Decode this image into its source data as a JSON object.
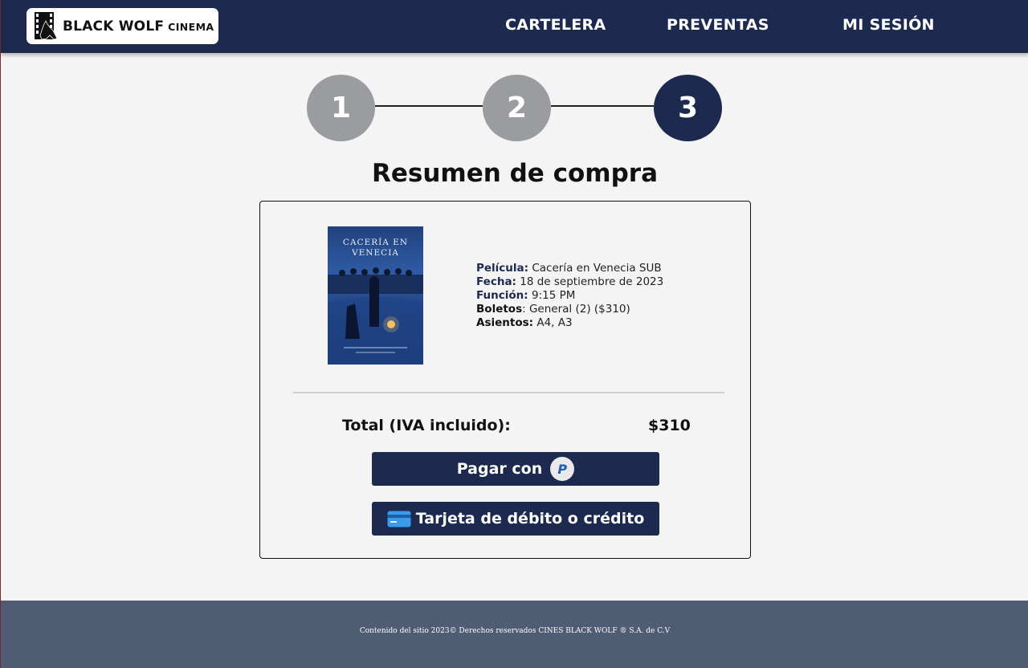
{
  "header": {
    "brand": "BLACK WOLF",
    "brand_sub": "CINEMA",
    "nav": [
      {
        "label": "CARTELERA"
      },
      {
        "label": "PREVENTAS"
      },
      {
        "label": "MI SESIÓN"
      }
    ]
  },
  "stepper": {
    "steps": [
      "1",
      "2",
      "3"
    ],
    "current": 3
  },
  "summary": {
    "title": "Resumen de compra",
    "poster_title": "CACERÍA EN VENECIA",
    "details": [
      {
        "label": "Película:",
        "value": " Cacería en Venecia SUB"
      },
      {
        "label": "Fecha:",
        "value": " 18 de septiembre de 2023"
      },
      {
        "label": "Función:",
        "value": " 9:15 PM"
      },
      {
        "label": "Boletos",
        "value": ": General (2) ($310)"
      },
      {
        "label": "Asientos:",
        "value": " A4, A3"
      }
    ],
    "total_label": "Total (IVA incluido):",
    "total_value": "$310",
    "pay_paypal_label": "Pagar con",
    "paypal_icon": "P",
    "pay_card_label": "Tarjeta de débito o crédito"
  },
  "footer": {
    "text": "Contenido del sitio 2023© Derechos reservados CINES BLACK WOLF ® S.A. de C.V"
  },
  "colors": {
    "primary": "#1b2a4e",
    "step_done": "#9a9c9f",
    "footer_bg": "#4e5c74",
    "page_bg": "#f4f4f4"
  }
}
